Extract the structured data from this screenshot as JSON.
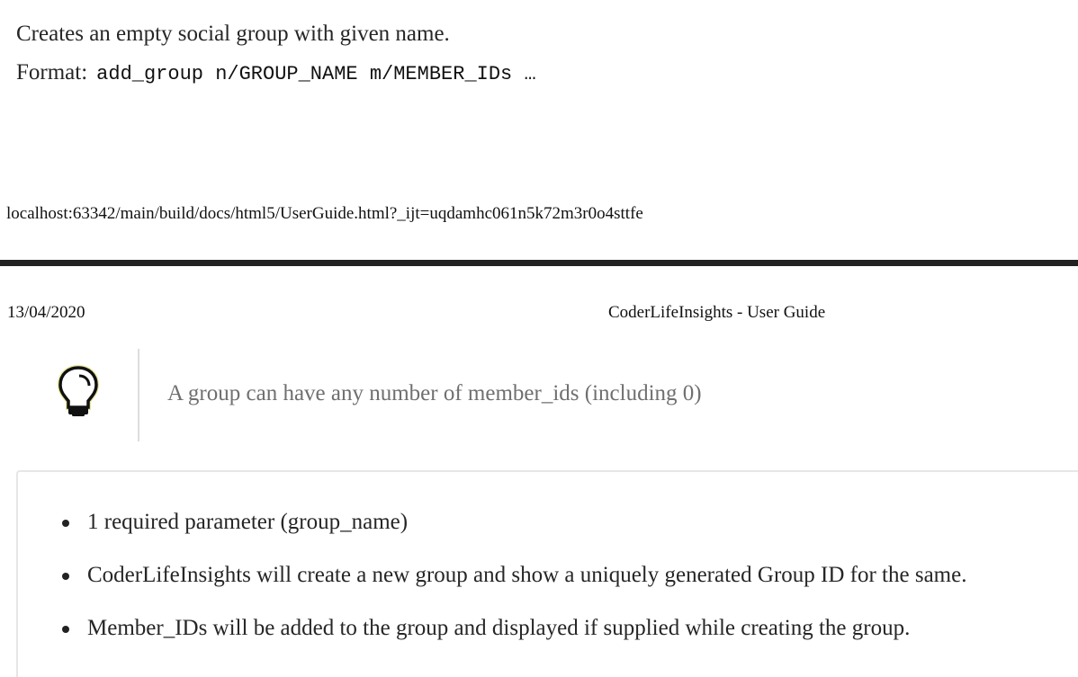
{
  "command": {
    "description": "Creates an empty social group with given name.",
    "format_label": "Format:",
    "format_code": "add_group n/GROUP_NAME m/MEMBER_IDs …"
  },
  "print_footer": {
    "url": "localhost:63342/main/build/docs/html5/UserGuide.html?_ijt=uqdamhc061n5k72m3r0o4sttfe"
  },
  "print_header": {
    "date": "13/04/2020",
    "title": "CoderLifeInsights - User Guide"
  },
  "tip": {
    "icon": "lightbulb-icon",
    "text": "A group can have any number of member_ids (including 0)"
  },
  "notes": {
    "items": [
      "1 required parameter (group_name)",
      "CoderLifeInsights will create a new group and show a uniquely generated Group ID for the same.",
      "Member_IDs will be added to the group and displayed if supplied while creating the group."
    ]
  }
}
